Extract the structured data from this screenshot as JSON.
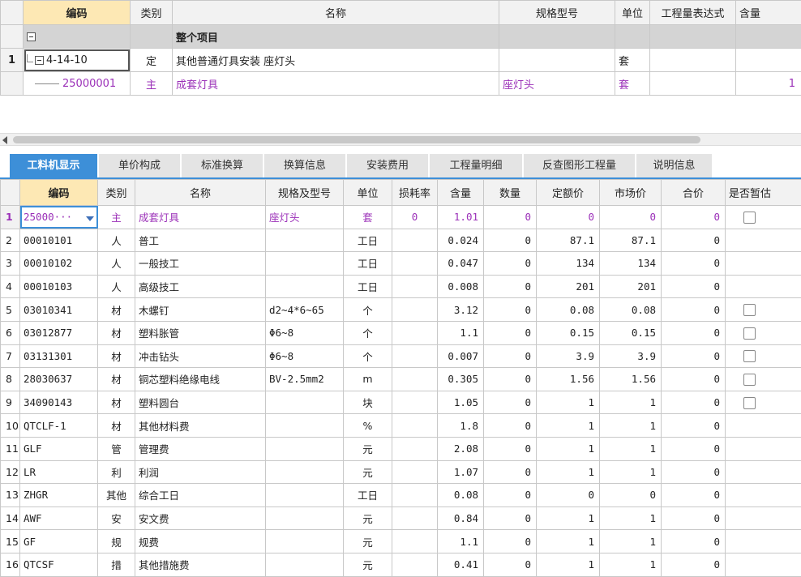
{
  "top_grid": {
    "headers": [
      "编码",
      "类别",
      "名称",
      "规格型号",
      "单位",
      "工程量表达式",
      "含量"
    ],
    "group_row": {
      "name": "整个项目"
    },
    "rows": [
      {
        "rownum": "1",
        "code": "4-14-10",
        "type": "定",
        "name": "其他普通灯具安装 座灯头",
        "spec": "",
        "unit": "套",
        "expr": "",
        "qty": ""
      },
      {
        "rownum": "",
        "code": "25000001",
        "type": "主",
        "name": "成套灯具",
        "spec": "座灯头",
        "unit": "套",
        "expr": "",
        "qty": "1"
      }
    ]
  },
  "tabs": [
    "工料机显示",
    "单价构成",
    "标准换算",
    "换算信息",
    "安装费用",
    "工程量明细",
    "反查图形工程量",
    "说明信息"
  ],
  "bottom_grid": {
    "headers": [
      "编码",
      "类别",
      "名称",
      "规格及型号",
      "单位",
      "损耗率",
      "含量",
      "数量",
      "定额价",
      "市场价",
      "合价",
      "是否暂估"
    ],
    "rows": [
      {
        "n": "1",
        "code": "25000···",
        "type": "主",
        "name": "成套灯具",
        "spec": "座灯头",
        "unit": "套",
        "loss": "0",
        "qty": "1.01",
        "amount": "0",
        "quota": "0",
        "market": "0",
        "total": "0",
        "check": true
      },
      {
        "n": "2",
        "code": "00010101",
        "type": "人",
        "name": "普工",
        "spec": "",
        "unit": "工日",
        "loss": "",
        "qty": "0.024",
        "amount": "0",
        "quota": "87.1",
        "market": "87.1",
        "total": "0",
        "check": false
      },
      {
        "n": "3",
        "code": "00010102",
        "type": "人",
        "name": "一般技工",
        "spec": "",
        "unit": "工日",
        "loss": "",
        "qty": "0.047",
        "amount": "0",
        "quota": "134",
        "market": "134",
        "total": "0",
        "check": false
      },
      {
        "n": "4",
        "code": "00010103",
        "type": "人",
        "name": "高级技工",
        "spec": "",
        "unit": "工日",
        "loss": "",
        "qty": "0.008",
        "amount": "0",
        "quota": "201",
        "market": "201",
        "total": "0",
        "check": false
      },
      {
        "n": "5",
        "code": "03010341",
        "type": "材",
        "name": "木螺钉",
        "spec": "d2~4*6~65",
        "unit": "个",
        "loss": "",
        "qty": "3.12",
        "amount": "0",
        "quota": "0.08",
        "market": "0.08",
        "total": "0",
        "check": true
      },
      {
        "n": "6",
        "code": "03012877",
        "type": "材",
        "name": "塑料胀管",
        "spec": "Φ6~8",
        "unit": "个",
        "loss": "",
        "qty": "1.1",
        "amount": "0",
        "quota": "0.15",
        "market": "0.15",
        "total": "0",
        "check": true
      },
      {
        "n": "7",
        "code": "03131301",
        "type": "材",
        "name": "冲击钻头",
        "spec": "Φ6~8",
        "unit": "个",
        "loss": "",
        "qty": "0.007",
        "amount": "0",
        "quota": "3.9",
        "market": "3.9",
        "total": "0",
        "check": true
      },
      {
        "n": "8",
        "code": "28030637",
        "type": "材",
        "name": "铜芯塑料绝缘电线",
        "spec": "BV-2.5mm2",
        "unit": "m",
        "loss": "",
        "qty": "0.305",
        "amount": "0",
        "quota": "1.56",
        "market": "1.56",
        "total": "0",
        "check": true
      },
      {
        "n": "9",
        "code": "34090143",
        "type": "材",
        "name": "塑料圆台",
        "spec": "",
        "unit": "块",
        "loss": "",
        "qty": "1.05",
        "amount": "0",
        "quota": "1",
        "market": "1",
        "total": "0",
        "check": true
      },
      {
        "n": "10",
        "code": "QTCLF-1",
        "type": "材",
        "name": "其他材料费",
        "spec": "",
        "unit": "%",
        "loss": "",
        "qty": "1.8",
        "amount": "0",
        "quota": "1",
        "market": "1",
        "total": "0",
        "check": false
      },
      {
        "n": "11",
        "code": "GLF",
        "type": "管",
        "name": "管理费",
        "spec": "",
        "unit": "元",
        "loss": "",
        "qty": "2.08",
        "amount": "0",
        "quota": "1",
        "market": "1",
        "total": "0",
        "check": false
      },
      {
        "n": "12",
        "code": "LR",
        "type": "利",
        "name": "利润",
        "spec": "",
        "unit": "元",
        "loss": "",
        "qty": "1.07",
        "amount": "0",
        "quota": "1",
        "market": "1",
        "total": "0",
        "check": false
      },
      {
        "n": "13",
        "code": "ZHGR",
        "type": "其他",
        "name": "综合工日",
        "spec": "",
        "unit": "工日",
        "loss": "",
        "qty": "0.08",
        "amount": "0",
        "quota": "0",
        "market": "0",
        "total": "0",
        "check": false
      },
      {
        "n": "14",
        "code": "AWF",
        "type": "安",
        "name": "安文费",
        "spec": "",
        "unit": "元",
        "loss": "",
        "qty": "0.84",
        "amount": "0",
        "quota": "1",
        "market": "1",
        "total": "0",
        "check": false
      },
      {
        "n": "15",
        "code": "GF",
        "type": "规",
        "name": "规费",
        "spec": "",
        "unit": "元",
        "loss": "",
        "qty": "1.1",
        "amount": "0",
        "quota": "1",
        "market": "1",
        "total": "0",
        "check": false
      },
      {
        "n": "16",
        "code": "QTCSF",
        "type": "措",
        "name": "其他措施费",
        "spec": "",
        "unit": "元",
        "loss": "",
        "qty": "0.41",
        "amount": "0",
        "quota": "1",
        "market": "1",
        "total": "0",
        "check": false
      }
    ]
  },
  "colors": {
    "accent": "#3d8fd8",
    "header_highlight": "#fde8b4",
    "main_material_text": "#9b30b8",
    "group_row": "#d4d4d4"
  }
}
